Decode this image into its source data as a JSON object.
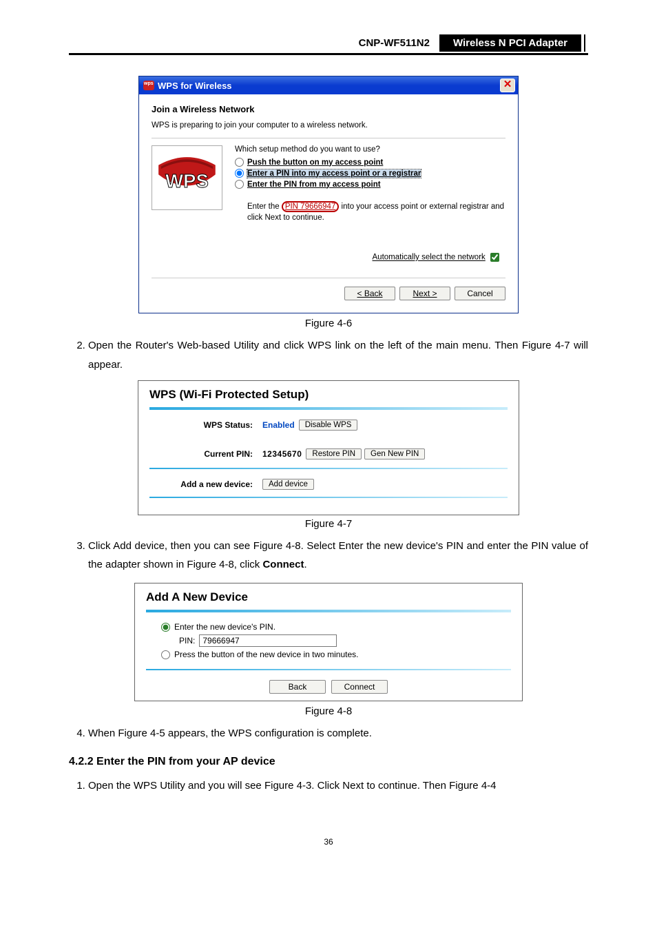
{
  "header": {
    "model": "CNP-WF511N2",
    "product": "Wireless N PCI Adapter"
  },
  "dialog1": {
    "title": "WPS for Wireless",
    "heading": "Join a Wireless Network",
    "subtext": "WPS is preparing to join your computer to a wireless network.",
    "question": "Which setup method do you want to use?",
    "opt1": "Push the button on my access point",
    "opt2": "Enter a PIN into my access point or a registrar",
    "opt3": "Enter the PIN from my access point",
    "pin_pre": "Enter the ",
    "pin_bold": "PIN 79666947",
    "pin_post": " into your access point or external registrar and click Next to continue.",
    "autosel_label": "Automatically select the network",
    "back": "< Back",
    "next": "Next >",
    "cancel": "Cancel"
  },
  "captions": {
    "f46": "Figure 4-6",
    "f47": "Figure 4-7",
    "f48": "Figure 4-8"
  },
  "step2": {
    "num": "2.",
    "text_a": "Open the Router's Web-based Utility and click WPS link on the left of the main menu. Then Figure 4-7 will appear."
  },
  "panel2": {
    "title": "WPS (Wi-Fi Protected Setup)",
    "status_label": "WPS Status:",
    "status_value": "Enabled",
    "disable_btn": "Disable WPS",
    "pin_label": "Current PIN:",
    "pin_value": "12345670",
    "restore_btn": "Restore PIN",
    "gen_btn": "Gen New PIN",
    "add_label": "Add a new device:",
    "add_btn": "Add device"
  },
  "step3": {
    "num": "3.",
    "text": "Click Add device, then you can see Figure 4-8. Select Enter the new device's PIN and enter the PIN value of the adapter shown in Figure 4-8, click ",
    "connect_b": "Connect",
    "period": "."
  },
  "panel3": {
    "title": "Add A New Device",
    "opt1": "Enter the new device's PIN.",
    "pin_label": "PIN:",
    "pin_value": "79666947",
    "opt2": "Press the button of the new device in two minutes.",
    "back": "Back",
    "connect": "Connect"
  },
  "step4": {
    "num": "4.",
    "text": "When Figure 4-5 appears, the WPS configuration is complete."
  },
  "section": {
    "num_title": "4.2.2  Enter the PIN from your AP device"
  },
  "step_s1": {
    "num": "1.",
    "text": "Open the WPS Utility and you will see Figure 4-3. Click Next to continue. Then Figure 4-4"
  },
  "page_number": "36"
}
